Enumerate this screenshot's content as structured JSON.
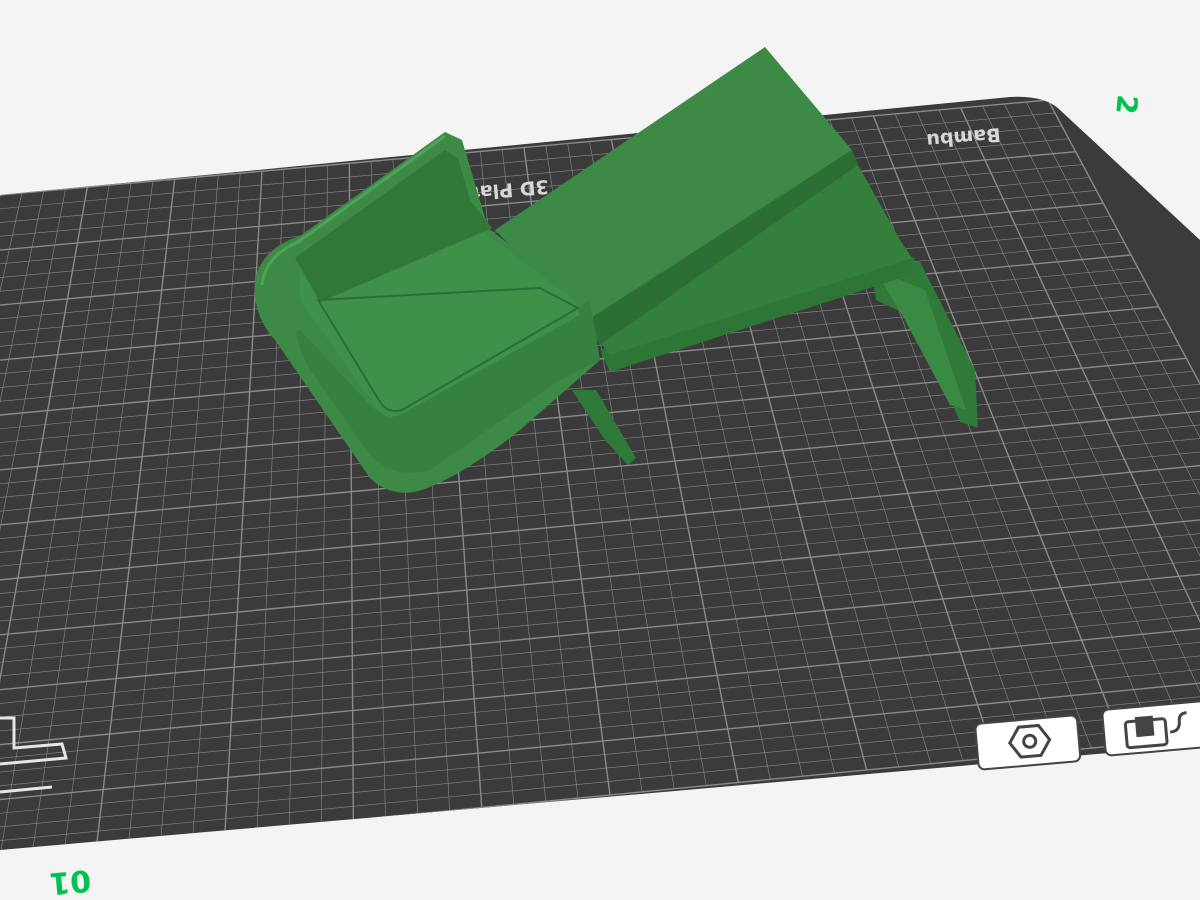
{
  "viewport": {
    "background": "#f4f4f4",
    "plate_color": "#3b3b3b",
    "grid_color": "#8a8a8a",
    "model_color": "#3c8a45",
    "accent_color": "#00c250"
  },
  "plate": {
    "brand_text": "Bambu",
    "type_text": "3D Plate",
    "plate_number": "01",
    "corner_marker": "2"
  },
  "toolbar": {
    "items": [
      {
        "name": "arrange-nut-icon",
        "tooltip": ""
      },
      {
        "name": "lock-plate-icon",
        "tooltip": ""
      }
    ]
  }
}
